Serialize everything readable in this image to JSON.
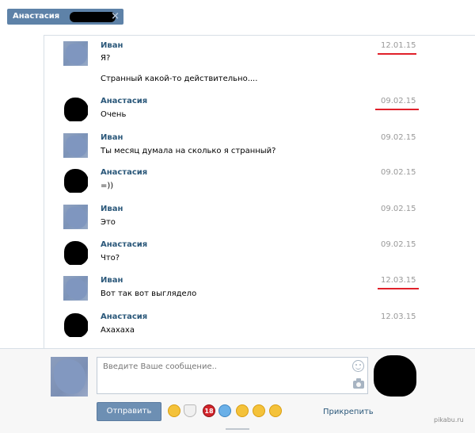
{
  "tab": {
    "title": "Анастасия",
    "close": "×"
  },
  "messages": [
    {
      "author": "Иван",
      "date": "12.01.15",
      "lines": [
        "Я?",
        "Странный какой-то действительно...."
      ],
      "highlighted": true
    },
    {
      "author": "Анастасия",
      "date": "09.02.15",
      "lines": [
        "Очень"
      ],
      "highlighted": true
    },
    {
      "author": "Иван",
      "date": "09.02.15",
      "lines": [
        "Ты месяц думала на сколько я странный?"
      ],
      "highlighted": false
    },
    {
      "author": "Анастасия",
      "date": "09.02.15",
      "lines": [
        "=))"
      ],
      "highlighted": false
    },
    {
      "author": "Иван",
      "date": "09.02.15",
      "lines": [
        "Это"
      ],
      "highlighted": false
    },
    {
      "author": "Анастасия",
      "date": "09.02.15",
      "lines": [
        "Что?"
      ],
      "highlighted": false
    },
    {
      "author": "Иван",
      "date": "12.03.15",
      "lines": [
        "Вот так вот выглядело"
      ],
      "highlighted": true
    },
    {
      "author": "Анастасия",
      "date": "12.03.15",
      "lines": [
        "Ахахаха"
      ],
      "highlighted": false
    }
  ],
  "composer": {
    "placeholder": "Введите Ваше сообщение..",
    "send_label": "Отправить",
    "attach_label": "Прикрепить",
    "emoji_icons": [
      "blush-emoji-icon",
      "toilet-emoji-icon",
      "18-emoji-icon",
      "scream-emoji-icon",
      "smile-emoji-icon",
      "confused-emoji-icon",
      "rolleyes-emoji-icon"
    ],
    "age_badge": "18"
  },
  "watermark": "pikabu.ru",
  "colors": {
    "accent": "#5e82a8",
    "author": "#2b587a",
    "date": "#999999",
    "highlight": "#e0202a"
  }
}
